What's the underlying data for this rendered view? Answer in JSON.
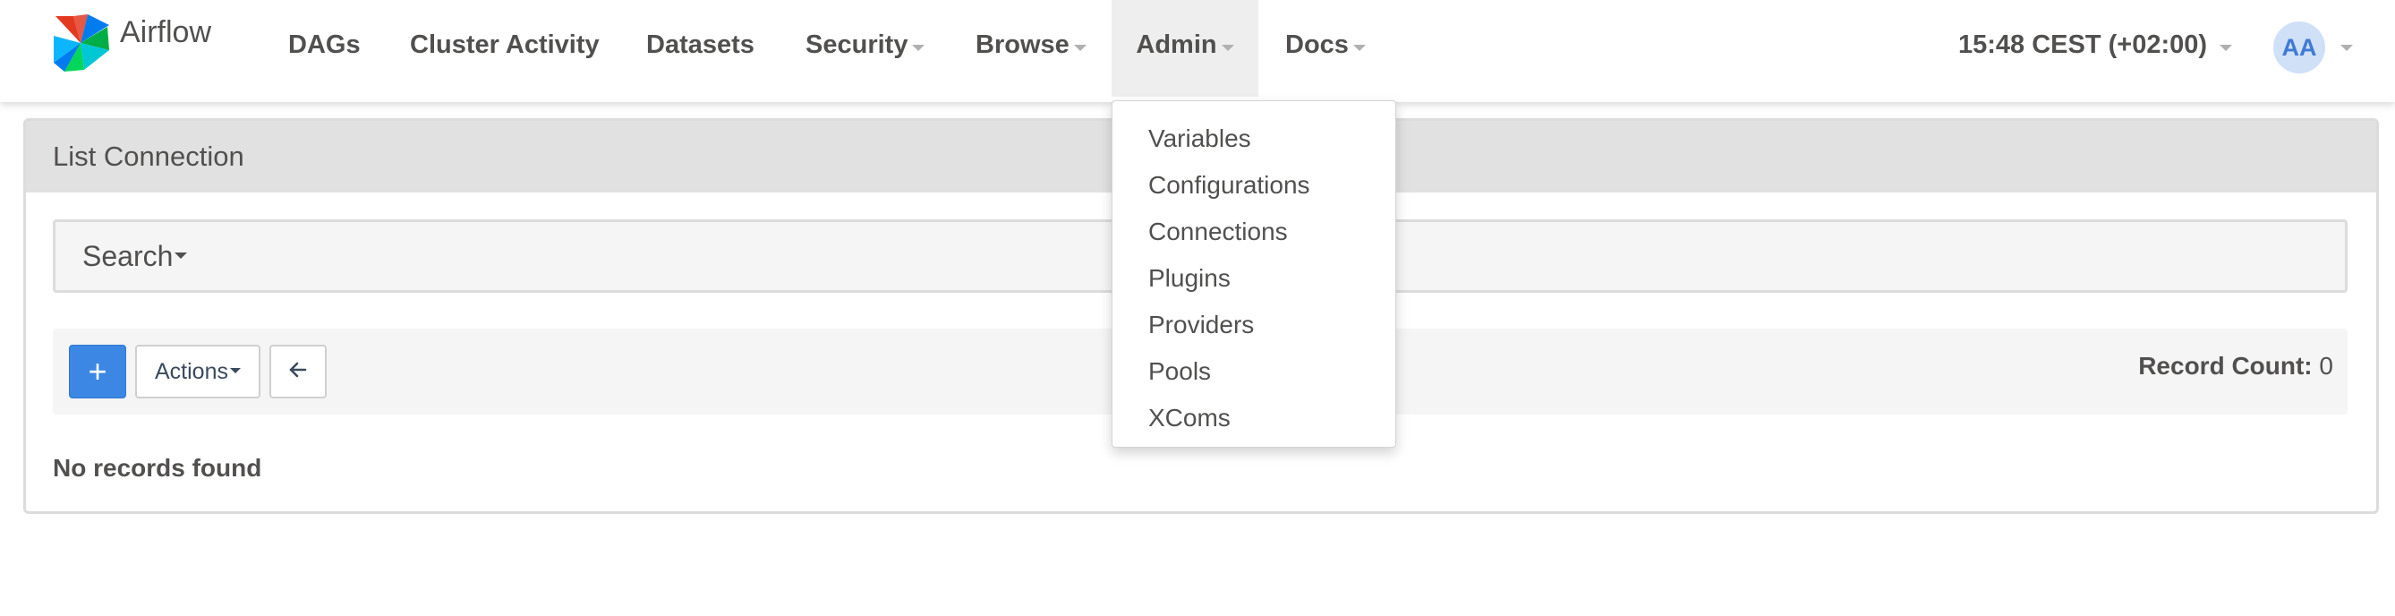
{
  "brand": {
    "name": "Airflow",
    "logo_icon": "airflow-pinwheel-icon"
  },
  "nav": {
    "items": [
      {
        "label": "DAGs",
        "has_dropdown": false
      },
      {
        "label": "Cluster Activity",
        "has_dropdown": false
      },
      {
        "label": "Datasets",
        "has_dropdown": false
      },
      {
        "label": "Security",
        "has_dropdown": true
      },
      {
        "label": "Browse",
        "has_dropdown": true
      },
      {
        "label": "Admin",
        "has_dropdown": true,
        "active": true
      },
      {
        "label": "Docs",
        "has_dropdown": true
      }
    ],
    "timezone": "15:48 CEST (+02:00)",
    "user_initials": "AA"
  },
  "admin_menu": {
    "items": [
      "Variables",
      "Configurations",
      "Connections",
      "Plugins",
      "Providers",
      "Pools",
      "XComs"
    ]
  },
  "panel": {
    "title": "List Connection",
    "search_label": "Search",
    "add_label": "+",
    "actions_label": "Actions",
    "back_icon": "arrow-left-icon",
    "record_count_label": "Record Count:",
    "record_count_value": "0",
    "empty_message": "No records found"
  },
  "colors": {
    "primary_button": "#3c87e3",
    "active_nav_bg": "#eeeeee",
    "avatar_bg": "#cfe0f7",
    "avatar_text": "#3f7ad4"
  }
}
